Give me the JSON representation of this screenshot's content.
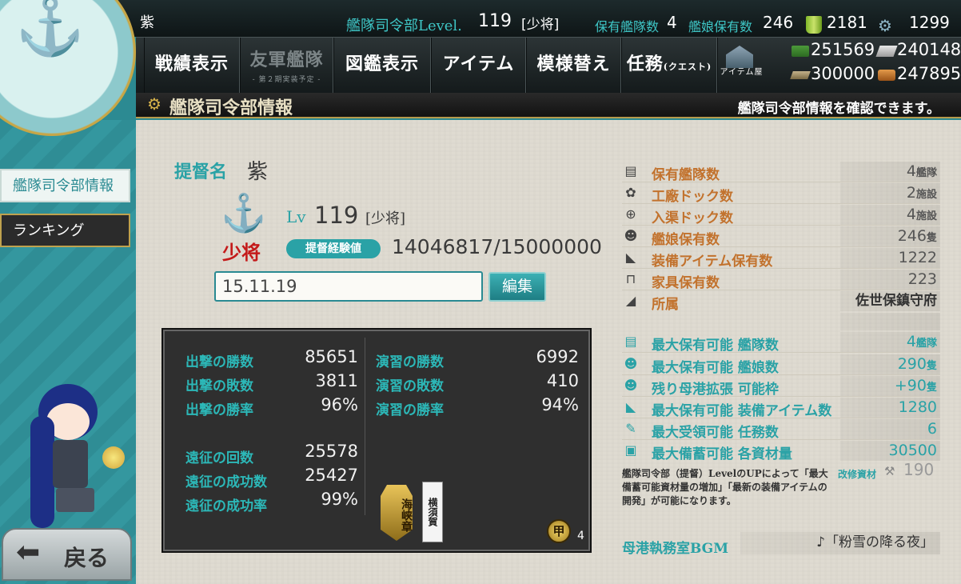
{
  "top": {
    "player_name": "紫",
    "hq_level_label": "艦隊司令部Level.",
    "hq_level": "119",
    "rank": "[少将]",
    "fleets_label": "保有艦隊数",
    "fleets_count": "4",
    "ships_label": "艦娘保有数",
    "ships_count": "246",
    "buckets": "2181",
    "dev_mats": "1299"
  },
  "nav": [
    {
      "label": "戦績表示"
    },
    {
      "label": "友軍艦隊",
      "sub": "- 第２期実装予定 -"
    },
    {
      "label": "図鑑表示"
    },
    {
      "label": "アイテム"
    },
    {
      "label": "模様替え"
    },
    {
      "label": "任務",
      "small": "(クエスト)"
    },
    {
      "label": "アイテム屋"
    }
  ],
  "resources": {
    "fuel": "251569",
    "ammo": "240148",
    "steel": "300000",
    "bauxite": "247895"
  },
  "header": {
    "title": "艦隊司令部情報",
    "hint": "艦隊司令部情報を確認できます。"
  },
  "sidebar": {
    "items": [
      "艦隊司令部情報",
      "ランキング"
    ],
    "back": "戻る"
  },
  "profile": {
    "name_label": "提督名",
    "name": "紫",
    "lv_label": "Lv",
    "lv": "119",
    "rank": "[少将]",
    "rank_badge": "少将",
    "exp_label": "提督経験値",
    "exp": "14046817/15000000",
    "comment": "15.11.19",
    "edit_button": "編集"
  },
  "stats": {
    "sortie_wins_label": "出撃の勝数",
    "sortie_wins": "85651",
    "sortie_losses_label": "出撃の敗数",
    "sortie_losses": "3811",
    "sortie_rate_label": "出撃の勝率",
    "sortie_rate": "96%",
    "exercise_wins_label": "演習の勝数",
    "exercise_wins": "6992",
    "exercise_losses_label": "演習の敗数",
    "exercise_losses": "410",
    "exercise_rate_label": "演習の勝率",
    "exercise_rate": "94%",
    "expedition_count_label": "遠征の回数",
    "expedition_count": "25578",
    "expedition_success_label": "遠征の成功数",
    "expedition_success": "25427",
    "expedition_rate_label": "遠征の成功率",
    "expedition_rate": "99%",
    "medal1": "海峡章",
    "medal2": "横須賀",
    "kou_count": "4",
    "kou_symbol": "甲"
  },
  "right": {
    "rows": [
      {
        "label": "保有艦隊数",
        "value": "4",
        "unit": "艦隊"
      },
      {
        "label": "工廠ドック数",
        "value": "2",
        "unit": "施設"
      },
      {
        "label": "入渠ドック数",
        "value": "4",
        "unit": "施設"
      },
      {
        "label": "艦娘保有数",
        "value": "246",
        "unit": "隻"
      },
      {
        "label": "装備アイテム保有数",
        "value": "1222",
        "unit": ""
      },
      {
        "label": "家具保有数",
        "value": "223",
        "unit": ""
      },
      {
        "label": "所属",
        "value": "佐世保鎮守府",
        "unit": ""
      }
    ],
    "max_rows": [
      {
        "label": "最大保有可能 艦隊数",
        "value": "4",
        "unit": "艦隊"
      },
      {
        "label": "最大保有可能 艦娘数",
        "value": "290",
        "unit": "隻"
      },
      {
        "label": "残り母港拡張 可能枠",
        "value": "+90",
        "unit": "隻"
      },
      {
        "label": "最大保有可能 装備アイテム数",
        "value": "1280",
        "unit": ""
      },
      {
        "label": "最大受領可能 任務数",
        "value": "6",
        "unit": ""
      },
      {
        "label": "最大備蓄可能 各資材量",
        "value": "30500",
        "unit": ""
      }
    ],
    "note": "艦隊司令部（提督）LevelのUPによって「最大備蓄可能資材量の増加」「最新の装備アイテムの開発」が可能になります。",
    "kaishu_label": "改修資材",
    "kaishu_value": "190",
    "bgm_label": "母港執務室BGM",
    "bgm_value": "♪「粉雪の降る夜」"
  },
  "colors": {
    "teal": "#2aa2a6",
    "gold": "#b59a4d"
  }
}
